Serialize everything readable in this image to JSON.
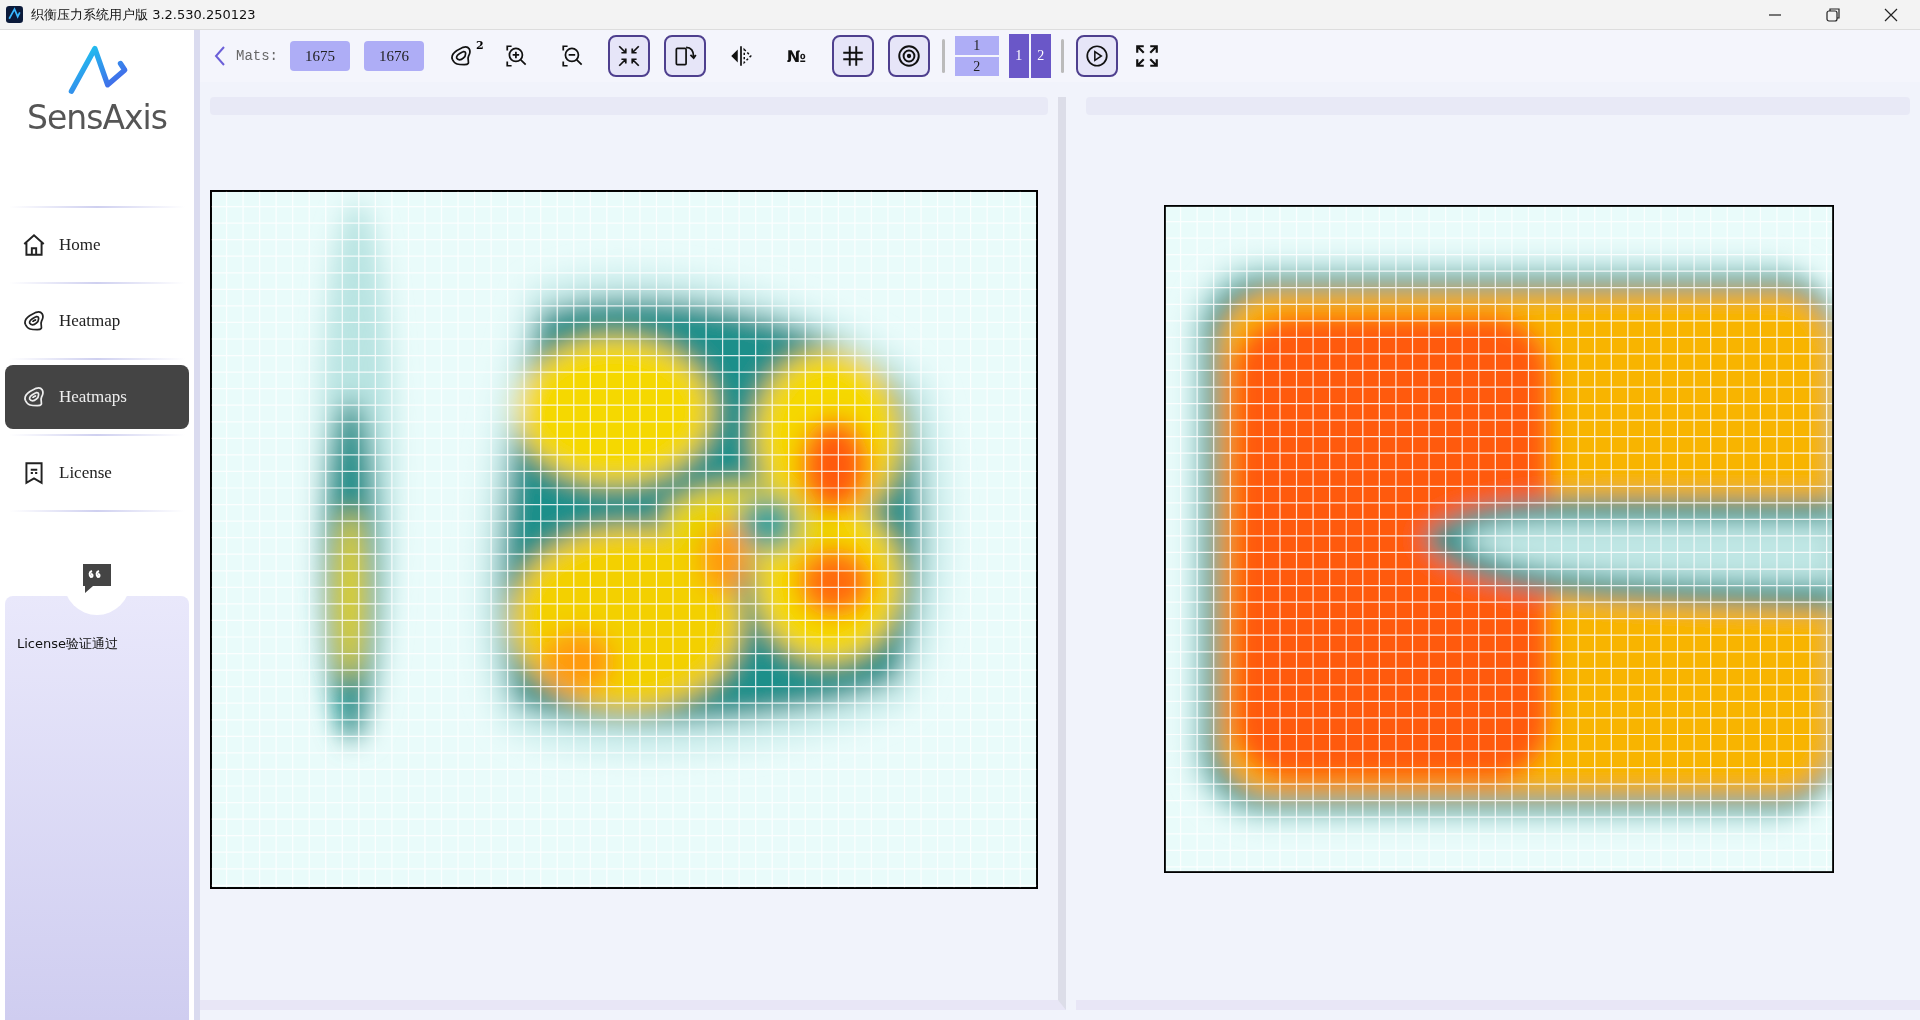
{
  "window": {
    "title": "织衡压力系统用户版 3.2.530.250123"
  },
  "sidebar": {
    "logo": {
      "text": "SensAxis"
    },
    "items": [
      {
        "label": "Home",
        "kind": "home",
        "selected": false
      },
      {
        "label": "Heatmap",
        "kind": "heatmap",
        "selected": false
      },
      {
        "label": "Heatmaps",
        "kind": "heatmap",
        "selected": true
      },
      {
        "label": "License",
        "kind": "license",
        "selected": false
      }
    ],
    "notice": {
      "text": "License验证通过"
    }
  },
  "toolbar": {
    "mats_label": "Mats:",
    "mats": [
      "1675",
      "1676"
    ],
    "tools": [
      {
        "kind": "heatmap",
        "badge": "2",
        "framed": false
      },
      {
        "kind": "zoom-in",
        "framed": false
      },
      {
        "kind": "zoom-out",
        "framed": false
      },
      {
        "kind": "shrink",
        "framed": true
      },
      {
        "kind": "rotate",
        "framed": true
      },
      {
        "kind": "mirror",
        "framed": false
      },
      {
        "kind": "number",
        "text": "№",
        "framed": false
      },
      {
        "kind": "grid",
        "framed": true
      },
      {
        "kind": "target",
        "framed": true
      }
    ],
    "fraction": {
      "numerator": "1",
      "denominator": "2"
    },
    "pages": [
      {
        "label": "1",
        "selected": true
      },
      {
        "label": "2",
        "selected": true
      }
    ],
    "play": {
      "framed": true
    }
  },
  "heatmaps": [
    {
      "kind": "four-pad"
    },
    {
      "kind": "seat"
    }
  ]
}
